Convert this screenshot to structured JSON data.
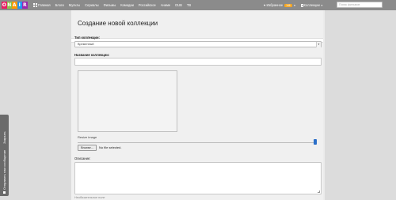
{
  "app": {
    "logo_letters": [
      "O",
      "N",
      "A",
      "I",
      "R"
    ],
    "logo_colors": [
      "#e91e63",
      "#8bc34a",
      "#ff9800",
      "#2196f3",
      "#9c27b0"
    ]
  },
  "nav": {
    "items": [
      {
        "label": "Главная",
        "icon": "tiles-icon"
      },
      {
        "label": "Блоги"
      },
      {
        "label": "Мульты"
      },
      {
        "label": "Сериалы"
      },
      {
        "label": "Фильмы"
      },
      {
        "label": "Комедии"
      },
      {
        "label": "Российское"
      },
      {
        "label": "Аниме"
      },
      {
        "label": "DUB"
      },
      {
        "label": "ТВ"
      }
    ],
    "favorites_label": "Избранное",
    "favorites_badge": "146",
    "collections_label": "Коллекции",
    "search_placeholder": "Поиск фильмов"
  },
  "form": {
    "title": "Создание новой коллекции",
    "type_label": "Тип коллекции:",
    "type_value": "Временный",
    "name_label": "Название коллекции:",
    "name_value": "",
    "resize_label": "Resize image",
    "browse_label": "Browse...",
    "no_file_label": "No file selected.",
    "description_label": "Описание:",
    "required_note": "Необязательное поле"
  },
  "feedback": {
    "label": "Отправить нам сообщение",
    "extra": "Закрыть"
  },
  "colors": {
    "topbar": "#8b8b8b",
    "badge": "#f5a623",
    "slider_thumb": "#2a6fc9"
  }
}
